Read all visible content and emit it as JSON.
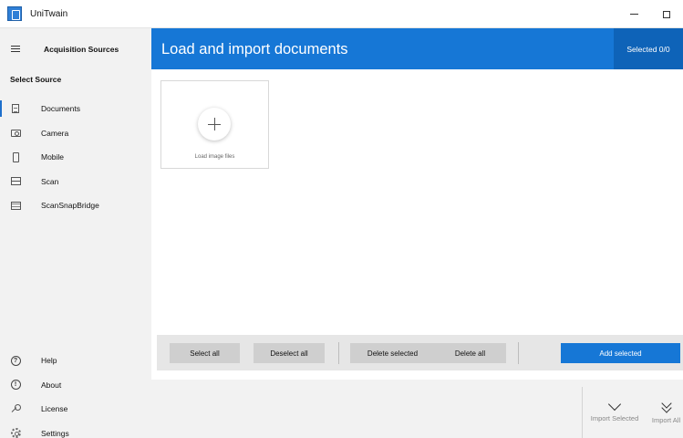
{
  "window": {
    "title": "UniTwain",
    "controls": [
      "minimize",
      "maximize"
    ]
  },
  "sidebar": {
    "menu_title": "Acquisition Sources",
    "section_label": "Select Source",
    "sources": [
      {
        "label": "Documents",
        "icon": "document-icon",
        "active": true
      },
      {
        "label": "Camera",
        "icon": "camera-icon",
        "active": false
      },
      {
        "label": "Mobile",
        "icon": "mobile-icon",
        "active": false
      },
      {
        "label": "Scan",
        "icon": "scanner-icon",
        "active": false
      },
      {
        "label": "ScanSnapBridge",
        "icon": "scansnap-icon",
        "active": false
      }
    ],
    "footer_items": [
      {
        "label": "Help",
        "icon": "help-icon"
      },
      {
        "label": "About",
        "icon": "info-icon"
      },
      {
        "label": "License",
        "icon": "key-icon"
      },
      {
        "label": "Settings",
        "icon": "gear-icon"
      }
    ]
  },
  "header": {
    "title": "Load and import documents",
    "selected_count": "Selected 0/0"
  },
  "content": {
    "load_tile_label": "Load image files"
  },
  "actions": {
    "select_all": "Select all",
    "deselect_all": "Deselect all",
    "delete_selected": "Delete selected",
    "delete_all": "Delete all",
    "add_selected": "Add selected"
  },
  "import": {
    "import_selected": "Import Selected",
    "import_all": "Import All"
  },
  "colors": {
    "accent": "#1677d6",
    "accent_dark": "#0e63b8",
    "sidebar_bg": "#f2f2f2"
  }
}
